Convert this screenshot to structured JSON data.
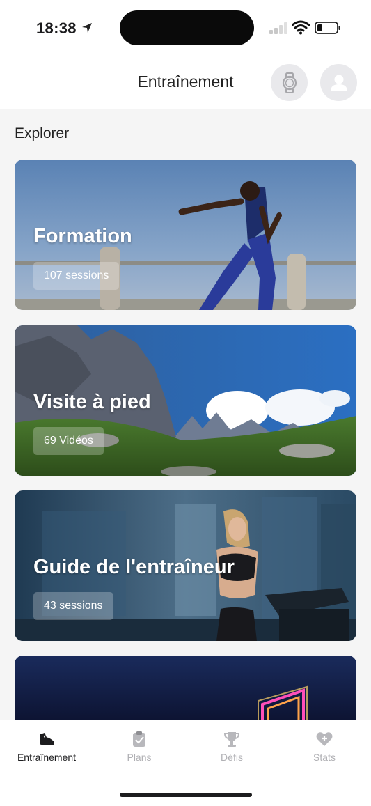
{
  "status_bar": {
    "time": "18:38"
  },
  "header": {
    "title": "Entraînement",
    "watch_icon": "watch-icon",
    "profile_icon": "user-icon"
  },
  "explore": {
    "title": "Explorer"
  },
  "cards": [
    {
      "title": "Formation",
      "badge": "107 sessions"
    },
    {
      "title": "Visite à pied",
      "badge": "69 Vidéos"
    },
    {
      "title": "Guide de l'entraîneur",
      "badge": "43 sessions"
    }
  ],
  "tabbar": {
    "items": [
      {
        "label": "Entraînement",
        "icon": "shoe-icon",
        "active": true
      },
      {
        "label": "Plans",
        "icon": "clipboard-icon",
        "active": false
      },
      {
        "label": "Défis",
        "icon": "trophy-icon",
        "active": false
      },
      {
        "label": "Stats",
        "icon": "heart-plus-icon",
        "active": false
      }
    ]
  },
  "colors": {
    "active": "#1c1c1e",
    "inactive": "#b0b0b4",
    "header_button_bg": "#e9e9ec"
  }
}
